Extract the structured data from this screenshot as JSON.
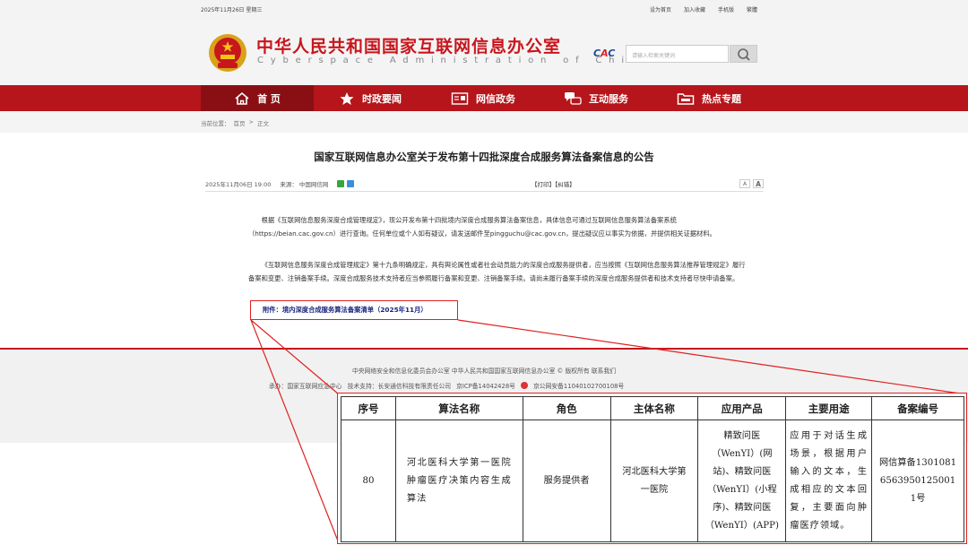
{
  "topbar": {
    "date": "2025年11月26日 星期三",
    "links": [
      "设为首页",
      "加入收藏",
      "手机版",
      "繁體"
    ]
  },
  "header": {
    "title": "中华人民共和国国家互联网信息办公室",
    "subtitle": "Cyberspace Administration of China",
    "search_placeholder": "请输入检索关键词"
  },
  "nav": {
    "items": [
      {
        "label": "首 页",
        "icon": "home-icon",
        "active": true
      },
      {
        "label": "时政要闻",
        "icon": "star-icon",
        "active": false
      },
      {
        "label": "网信政务",
        "icon": "document-icon",
        "active": false
      },
      {
        "label": "互动服务",
        "icon": "chat-icon",
        "active": false
      },
      {
        "label": "热点专题",
        "icon": "folder-icon",
        "active": false
      }
    ]
  },
  "breadcrumb": {
    "prefix": "当前位置：",
    "home": "首页",
    "sep": ">",
    "current": "正文"
  },
  "article": {
    "title": "国家互联网信息办公室关于发布第十四批深度合成服务算法备案信息的公告",
    "datetime": "2025年11月06日 19:00",
    "source_label": "来源：",
    "source": "中国网信网",
    "print_links": "【打印】【纠错】",
    "font_small": "A",
    "font_large": "A",
    "paragraph1": "根据《互联网信息服务深度合成管理规定》，现公开发布第十四批境内深度合成服务算法备案信息，具体信息可通过互联网信息服务算法备案系统（https://beian.cac.gov.cn）进行查询。任何单位或个人如有疑议，请发送邮件至pingguchu@cac.gov.cn，提出疑议应以事实为依据，并提供相关证据材料。",
    "paragraph2": "《互联网信息服务深度合成管理规定》第十九条明确规定，具有舆论属性或者社会动员能力的深度合成服务提供者，应当按照《互联网信息服务算法推荐管理规定》履行备案和变更、注销备案手续。深度合成服务技术支持者应当参照履行备案和变更、注销备案手续。请尚未履行备案手续的深度合成服务提供者和技术支持者尽快申请备案。",
    "attachment": "附件：境内深度合成服务算法备案清单（2025年11月）"
  },
  "footer": {
    "line1": "中央网络安全和信息化委员会办公室  中华人民共和国国家互联网信息办公室 © 版权所有  联系我们",
    "host": "承办：国家互联网应急中心",
    "tech": "技术支持：长安通信科技有限责任公司",
    "icp": "京ICP备14042428号",
    "police": "京公网安备11040102700108号"
  },
  "table": {
    "headers": [
      "序号",
      "算法名称",
      "角色",
      "主体名称",
      "应用产品",
      "主要用途",
      "备案编号"
    ],
    "rows": [
      {
        "no": "80",
        "name": "河北医科大学第一医院肿瘤医疗决策内容生成算法",
        "role": "服务提供者",
        "entity": "河北医科大学第一医院",
        "product": "精致问医（WenYI）(网站)、精致问医（WenYI）(小程序)、精致问医（WenYI）(APP)",
        "usage": "应用于对话生成场景，根据用户输入的文本，生成相应的文本回复，主要面向肿瘤医疗领域。",
        "record": "网信算备130108165639501250011号"
      }
    ]
  },
  "colors": {
    "brand_red": "#b5151b",
    "title_red": "#c8161d",
    "highlight": "#e02020",
    "link_blue": "#1a237e"
  }
}
